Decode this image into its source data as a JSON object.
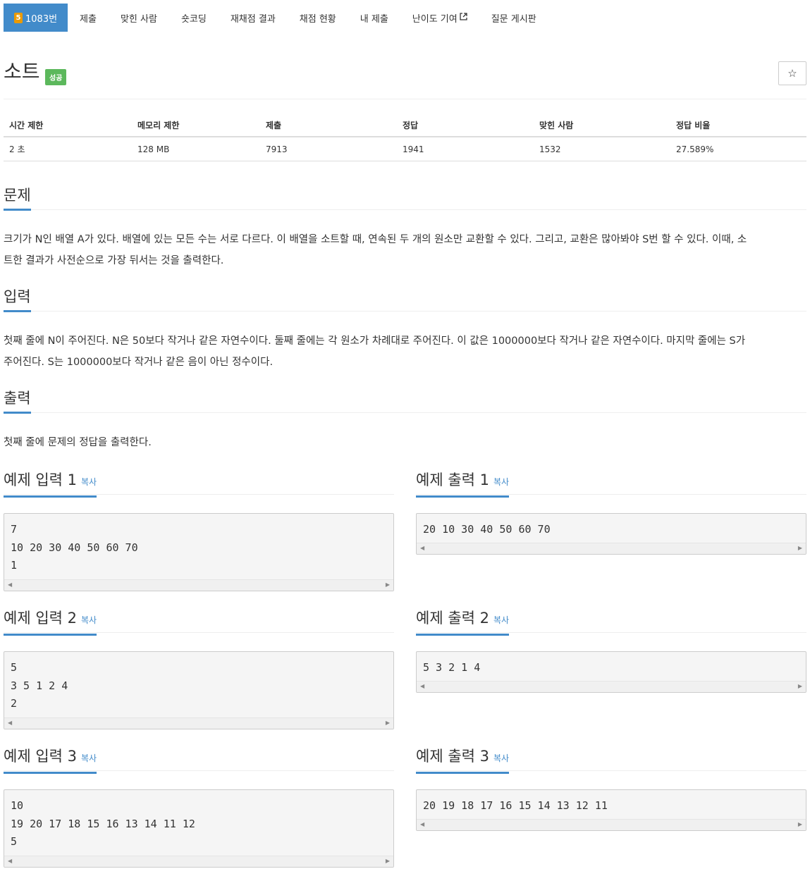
{
  "nav": {
    "tier": "5",
    "tabs": [
      "1083번",
      "제출",
      "맞힌 사람",
      "숏코딩",
      "재채점 결과",
      "채점 현황",
      "내 제출",
      "난이도 기여",
      "질문 게시판"
    ]
  },
  "problem": {
    "title": "소트",
    "result": "성공",
    "star": "☆"
  },
  "info": {
    "headers": [
      "시간 제한",
      "메모리 제한",
      "제출",
      "정답",
      "맞힌 사람",
      "정답 비율"
    ],
    "values": [
      "2 초",
      "128 MB",
      "7913",
      "1941",
      "1532",
      "27.589%"
    ]
  },
  "sections": {
    "problem_h": "문제",
    "problem_l1": "크기가 N인 배열 A가 있다. 배열에 있는 모든 수는 서로 다르다. 이 배열을 소트할 때, 연속된 두 개의 원소만 교환할 수 있다. 그리고, 교환은 많아봐야 S번 할 수 있다. 이때, 소",
    "problem_l2": "트한 결과가 사전순으로 가장 뒤서는 것을 출력한다.",
    "input_h": "입력",
    "input_l1": "첫째 줄에 N이 주어진다. N은 50보다 작거나 같은 자연수이다. 둘째 줄에는 각 원소가 차례대로 주어진다. 이 값은 1000000보다 작거나 같은 자연수이다. 마지막 줄에는 S가",
    "input_l2": "주어진다. S는 1000000보다 작거나 같은 음이 아닌 정수이다.",
    "output_h": "출력",
    "output_l1": "첫째 줄에 문제의 정답을 출력한다."
  },
  "samples": {
    "copy_label": "복사",
    "in1_title": "예제 입력 1",
    "out1_title": "예제 출력 1",
    "in2_title": "예제 입력 2",
    "out2_title": "예제 출력 2",
    "in3_title": "예제 입력 3",
    "out3_title": "예제 출력 3",
    "in1": "7\n10 20 30 40 50 60 70\n1",
    "out1": "20 10 30 40 50 60 70",
    "in2": "5\n3 5 1 2 4\n2",
    "out2": "5 3 2 1 4",
    "in3": "10\n19 20 17 18 15 16 13 14 11 12\n5",
    "out3": "20 19 18 17 16 15 14 13 12 11"
  }
}
